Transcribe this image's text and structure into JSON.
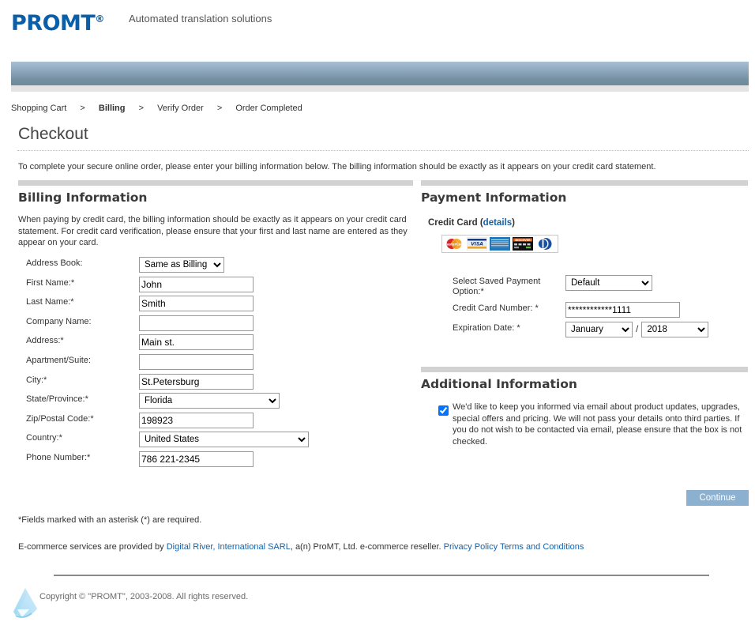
{
  "brand": {
    "name": "PROMT",
    "registered_mark": "®",
    "tagline": "Automated translation solutions"
  },
  "breadcrumb": {
    "items": [
      {
        "label": "Shopping Cart",
        "current": false
      },
      {
        "label": "Billing",
        "current": true
      },
      {
        "label": "Verify Order",
        "current": false
      },
      {
        "label": "Order Completed",
        "current": false
      }
    ],
    "separator": ">"
  },
  "page": {
    "title": "Checkout",
    "intro": "To complete your secure online order, please enter your billing information below. The billing information should be exactly as it appears on your credit card statement."
  },
  "billing": {
    "title": "Billing Information",
    "description": "When paying by credit card, the billing information should be exactly as it appears on your credit card statement. For credit card verification, please ensure that your first and last name are entered as they appear on your card.",
    "fields": [
      {
        "label": "Address Book:",
        "type": "select",
        "value": "Same as Billing",
        "width": "w108"
      },
      {
        "label": "First Name:*",
        "type": "text",
        "value": "John",
        "width": "w145"
      },
      {
        "label": "Last Name:*",
        "type": "text",
        "value": "Smith",
        "width": "w145"
      },
      {
        "label": "Company Name:",
        "type": "text",
        "value": "",
        "width": "w145"
      },
      {
        "label": "Address:*",
        "type": "text",
        "value": "Main st.",
        "width": "w145"
      },
      {
        "label": "Apartment/Suite:",
        "type": "text",
        "value": "",
        "width": "w145"
      },
      {
        "label": "City:*",
        "type": "text",
        "value": "St.Petersburg",
        "width": "w145"
      },
      {
        "label": "State/Province:*",
        "type": "select",
        "value": "Florida",
        "width": "w178"
      },
      {
        "label": "Zip/Postal Code:*",
        "type": "text",
        "value": "198923",
        "width": "w145"
      },
      {
        "label": "Country:*",
        "type": "select",
        "value": "United States",
        "width": "w215"
      },
      {
        "label": "Phone Number:*",
        "type": "text",
        "value": "786 221-2345",
        "width": "w145"
      }
    ]
  },
  "payment": {
    "title": "Payment Information",
    "credit_card_label": "Credit Card",
    "details_link": "details",
    "card_logos": [
      "mastercard-logo",
      "visa-logo",
      "amex-logo",
      "discover-logo",
      "diners-club-logo"
    ],
    "saved_option_label": "Select Saved Payment Option:*",
    "saved_option_value": "Default",
    "card_number_label": "Credit Card Number: *",
    "card_number_value": "************1111",
    "expiration_label": "Expiration Date: *",
    "expiration_month": "January",
    "expiration_separator": "/",
    "expiration_year": "2018"
  },
  "additional": {
    "title": "Additional Information",
    "checkbox_checked": true,
    "text": "We'd like to keep you informed via email about product updates, upgrades, special offers and pricing. We will not pass your details onto third parties. If you do not wish to be contacted via email, please ensure that the box is not checked."
  },
  "actions": {
    "continue_label": "Continue"
  },
  "footer": {
    "required_note": "*Fields marked with an asterisk (*) are required.",
    "ecommerce_prefix": "E-commerce services are provided by ",
    "link_digital_river": "Digital River, International SARL",
    "ecommerce_middle": ", a(n) ProMT, Ltd. e-commerce reseller. ",
    "link_privacy": "Privacy Policy",
    "link_terms": "Terms and Conditions",
    "copyright": "Copyright © \"PROMT\", 2003-2008. All rights reserved."
  },
  "colors": {
    "brand_blue": "#0B5EA8",
    "link_blue": "#1562a8",
    "bar_blue": "#74909f",
    "section_gray": "#d2d2d2",
    "button_blue": "#8cb0d0"
  }
}
